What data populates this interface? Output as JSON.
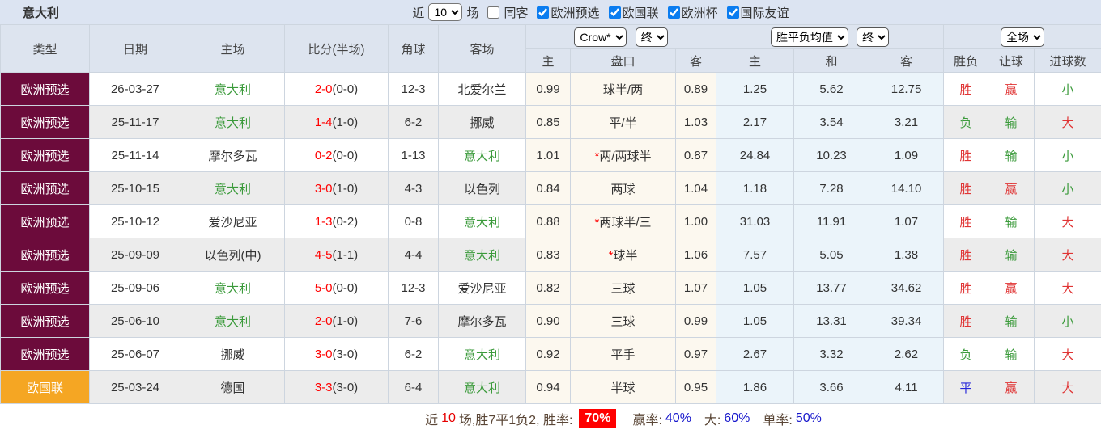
{
  "colors": {
    "type_maroon": "#6c0b3b",
    "type_orange": "#f5a623",
    "score_red": "#ff0000",
    "team_green": "#3a9a3a",
    "draw_blue": "#2626d9",
    "odds_bg": "#fcf8ef",
    "avg_bg": "#ebf4fa",
    "header_bg": "#dde4ef",
    "topbar_bg": "#dce4f2",
    "rate_chip_bg": "#ff0000"
  },
  "header_bar": {
    "title": "意大利",
    "recent_label": "近",
    "recent_select": "10",
    "games_label": "场",
    "same_away_label": "同客",
    "same_away_checked": false,
    "filters": [
      {
        "label": "欧洲预选",
        "checked": true
      },
      {
        "label": "欧国联",
        "checked": true
      },
      {
        "label": "欧洲杯",
        "checked": true
      },
      {
        "label": "国际友谊",
        "checked": true
      }
    ]
  },
  "table": {
    "columns": {
      "type": "类型",
      "date": "日期",
      "home": "主场",
      "score": "比分(半场)",
      "corner": "角球",
      "away": "客场"
    },
    "odds_group": {
      "company_select": "Crow*",
      "time_select": "终",
      "sub": [
        "主",
        "盘口",
        "客"
      ]
    },
    "avg_group": {
      "type_select": "胜平负均值",
      "time_select": "终",
      "sub": [
        "主",
        "和",
        "客"
      ]
    },
    "result_group": {
      "scope_select": "全场",
      "sub": [
        "胜负",
        "让球",
        "进球数"
      ]
    },
    "rows": [
      {
        "type": "欧洲预选",
        "type_class": "maroon",
        "date": "26-03-27",
        "home": "意大利",
        "home_color": "green",
        "score": "2-0",
        "half": "(0-0)",
        "corner": "12-3",
        "away": "北爱尔兰",
        "away_color": "dark",
        "odds_home": "0.99",
        "star": "",
        "handicap": "球半/两",
        "odds_away": "0.89",
        "avg_home": "1.25",
        "avg_draw": "5.62",
        "avg_away": "12.75",
        "result": "胜",
        "result_color": "red",
        "handicap_result": "赢",
        "handicap_result_color": "red",
        "goals_result": "小",
        "goals_result_color": "green"
      },
      {
        "type": "欧洲预选",
        "type_class": "maroon",
        "date": "25-11-17",
        "home": "意大利",
        "home_color": "green",
        "score": "1-4",
        "half": "(1-0)",
        "corner": "6-2",
        "away": "挪威",
        "away_color": "dark",
        "odds_home": "0.85",
        "star": "",
        "handicap": "平/半",
        "odds_away": "1.03",
        "avg_home": "2.17",
        "avg_draw": "3.54",
        "avg_away": "3.21",
        "result": "负",
        "result_color": "green",
        "handicap_result": "输",
        "handicap_result_color": "green",
        "goals_result": "大",
        "goals_result_color": "red"
      },
      {
        "type": "欧洲预选",
        "type_class": "maroon",
        "date": "25-11-14",
        "home": "摩尔多瓦",
        "home_color": "dark",
        "score": "0-2",
        "half": "(0-0)",
        "corner": "1-13",
        "away": "意大利",
        "away_color": "green",
        "odds_home": "1.01",
        "star": "*",
        "handicap": "两/两球半",
        "odds_away": "0.87",
        "avg_home": "24.84",
        "avg_draw": "10.23",
        "avg_away": "1.09",
        "result": "胜",
        "result_color": "red",
        "handicap_result": "输",
        "handicap_result_color": "green",
        "goals_result": "小",
        "goals_result_color": "green"
      },
      {
        "type": "欧洲预选",
        "type_class": "maroon",
        "date": "25-10-15",
        "home": "意大利",
        "home_color": "green",
        "score": "3-0",
        "half": "(1-0)",
        "corner": "4-3",
        "away": "以色列",
        "away_color": "dark",
        "odds_home": "0.84",
        "star": "",
        "handicap": "两球",
        "odds_away": "1.04",
        "avg_home": "1.18",
        "avg_draw": "7.28",
        "avg_away": "14.10",
        "result": "胜",
        "result_color": "red",
        "handicap_result": "赢",
        "handicap_result_color": "red",
        "goals_result": "小",
        "goals_result_color": "green"
      },
      {
        "type": "欧洲预选",
        "type_class": "maroon",
        "date": "25-10-12",
        "home": "爱沙尼亚",
        "home_color": "dark",
        "score": "1-3",
        "half": "(0-2)",
        "corner": "0-8",
        "away": "意大利",
        "away_color": "green",
        "odds_home": "0.88",
        "star": "*",
        "handicap": "两球半/三",
        "odds_away": "1.00",
        "avg_home": "31.03",
        "avg_draw": "11.91",
        "avg_away": "1.07",
        "result": "胜",
        "result_color": "red",
        "handicap_result": "输",
        "handicap_result_color": "green",
        "goals_result": "大",
        "goals_result_color": "red"
      },
      {
        "type": "欧洲预选",
        "type_class": "maroon",
        "date": "25-09-09",
        "home": "以色列(中)",
        "home_color": "dark",
        "score": "4-5",
        "half": "(1-1)",
        "corner": "4-4",
        "away": "意大利",
        "away_color": "green",
        "odds_home": "0.83",
        "star": "*",
        "handicap": "球半",
        "odds_away": "1.06",
        "avg_home": "7.57",
        "avg_draw": "5.05",
        "avg_away": "1.38",
        "result": "胜",
        "result_color": "red",
        "handicap_result": "输",
        "handicap_result_color": "green",
        "goals_result": "大",
        "goals_result_color": "red"
      },
      {
        "type": "欧洲预选",
        "type_class": "maroon",
        "date": "25-09-06",
        "home": "意大利",
        "home_color": "green",
        "score": "5-0",
        "half": "(0-0)",
        "corner": "12-3",
        "away": "爱沙尼亚",
        "away_color": "dark",
        "odds_home": "0.82",
        "star": "",
        "handicap": "三球",
        "odds_away": "1.07",
        "avg_home": "1.05",
        "avg_draw": "13.77",
        "avg_away": "34.62",
        "result": "胜",
        "result_color": "red",
        "handicap_result": "赢",
        "handicap_result_color": "red",
        "goals_result": "大",
        "goals_result_color": "red"
      },
      {
        "type": "欧洲预选",
        "type_class": "maroon",
        "date": "25-06-10",
        "home": "意大利",
        "home_color": "green",
        "score": "2-0",
        "half": "(1-0)",
        "corner": "7-6",
        "away": "摩尔多瓦",
        "away_color": "dark",
        "odds_home": "0.90",
        "star": "",
        "handicap": "三球",
        "odds_away": "0.99",
        "avg_home": "1.05",
        "avg_draw": "13.31",
        "avg_away": "39.34",
        "result": "胜",
        "result_color": "red",
        "handicap_result": "输",
        "handicap_result_color": "green",
        "goals_result": "小",
        "goals_result_color": "green"
      },
      {
        "type": "欧洲预选",
        "type_class": "maroon",
        "date": "25-06-07",
        "home": "挪威",
        "home_color": "dark",
        "score": "3-0",
        "half": "(3-0)",
        "corner": "6-2",
        "away": "意大利",
        "away_color": "green",
        "odds_home": "0.92",
        "star": "",
        "handicap": "平手",
        "odds_away": "0.97",
        "avg_home": "2.67",
        "avg_draw": "3.32",
        "avg_away": "2.62",
        "result": "负",
        "result_color": "green",
        "handicap_result": "输",
        "handicap_result_color": "green",
        "goals_result": "大",
        "goals_result_color": "red"
      },
      {
        "type": "欧国联",
        "type_class": "orange",
        "date": "25-03-24",
        "home": "德国",
        "home_color": "dark",
        "score": "3-3",
        "half": "(3-0)",
        "corner": "6-4",
        "away": "意大利",
        "away_color": "green",
        "odds_home": "0.94",
        "star": "",
        "handicap": "半球",
        "odds_away": "0.95",
        "avg_home": "1.86",
        "avg_draw": "3.66",
        "avg_away": "4.11",
        "result": "平",
        "result_color": "blue",
        "handicap_result": "赢",
        "handicap_result_color": "red",
        "goals_result": "大",
        "goals_result_color": "red"
      }
    ]
  },
  "summary": {
    "prefix": "近",
    "recent_num": "10",
    "record_text": "场,胜7平1负2, 胜率:",
    "win_rate": "70%",
    "handicap_label": "赢率:",
    "handicap_rate": "40%",
    "big_label": "大:",
    "big_rate": "60%",
    "single_label": "单率:",
    "single_rate": "50%"
  }
}
